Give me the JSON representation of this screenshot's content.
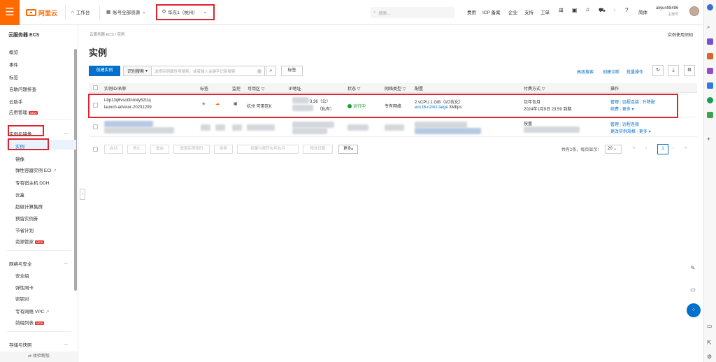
{
  "topbar": {
    "menu_icon": "hamburger-icon",
    "logo_text": "阿里云",
    "workbench": "工作台",
    "account_resources": "账号全部资源",
    "region": "华东1（杭州）",
    "search_placeholder": "搜索...",
    "links": [
      "费用",
      "ICP 备案",
      "企业",
      "支持",
      "工单"
    ],
    "lang": "简体",
    "username": "aliyun98486",
    "user_role": "主账号"
  },
  "sidebar": {
    "title": "云服务器 ECS",
    "top_items": [
      "概览",
      "事件",
      "标签",
      "自助问题排查",
      "云助手",
      "应用管理"
    ],
    "group1": {
      "label": "实例与镜像",
      "items": [
        "实例",
        "镜像",
        "弹性容器实例 ECI",
        "专有宿主机 DDH",
        "云盒",
        "超级计算集群",
        "预留实例券",
        "节省计划",
        "资源管家"
      ]
    },
    "group2": {
      "label": "网络与安全",
      "items": [
        "安全组",
        "弹性网卡",
        "密钥对",
        "专有网络 VPC",
        "前缀列表"
      ]
    },
    "group3": {
      "label": "存储与快照"
    },
    "hot_badge": "NEW",
    "bottom_label": "体验新版"
  },
  "main": {
    "breadcrumb": "云服务器 ECS / 实例",
    "doc_link": "实例使用须知",
    "title": "实例",
    "create_btn": "创建实例",
    "filter_select": "识别搜索",
    "filter_placeholder": "选择实例属性项搜索，或者输入关键字识别搜索",
    "tag_btn": "标签",
    "tools": [
      "高级搜索",
      "创建诊断",
      "批量操作"
    ]
  },
  "table": {
    "headers": {
      "id_name": "实例ID/名称",
      "tag": "标签",
      "monitor": "监控",
      "zone": "可用区",
      "ip": "IP地址",
      "status": "状态",
      "network": "网络类型",
      "config": "配置",
      "billing": "付费方式",
      "ops": "操作"
    },
    "rows": [
      {
        "id": "i-bp13q6vsoi3nm4y52l1q",
        "name": "launch-advisor-20231209",
        "zone": "杭州 可用区K",
        "ip_public_suffix": "3.36（公）",
        "ip_private_suffix": "（私有）",
        "status": "运行中",
        "network": "专有网络",
        "config_line1": "2 vCPU 1 GiB（I/O优化）",
        "config_type": "ecs.t6-c2m1.large",
        "bandwidth": "3Mbps",
        "billing_line1": "包年包月",
        "billing_line2": "2024年1月9日 23:59 到期",
        "ops_row1": [
          "管理",
          "远程连接",
          "升降配"
        ],
        "ops_row2": [
          "续费",
          "更多"
        ]
      },
      {
        "billing_line1": "按量",
        "ops_row1": [
          "管理",
          "远程连接"
        ],
        "ops_row2": [
          "更改实例规格",
          "更多"
        ]
      }
    ]
  },
  "bottombar": {
    "buttons": [
      "启动",
      "停止",
      "重启",
      "重置实例密码",
      "续费",
      "按量付费转包年包月",
      "释放设置"
    ],
    "more": "更多",
    "summary": "共有2条，每页显示：",
    "page_size": "20",
    "current_page": "1"
  }
}
